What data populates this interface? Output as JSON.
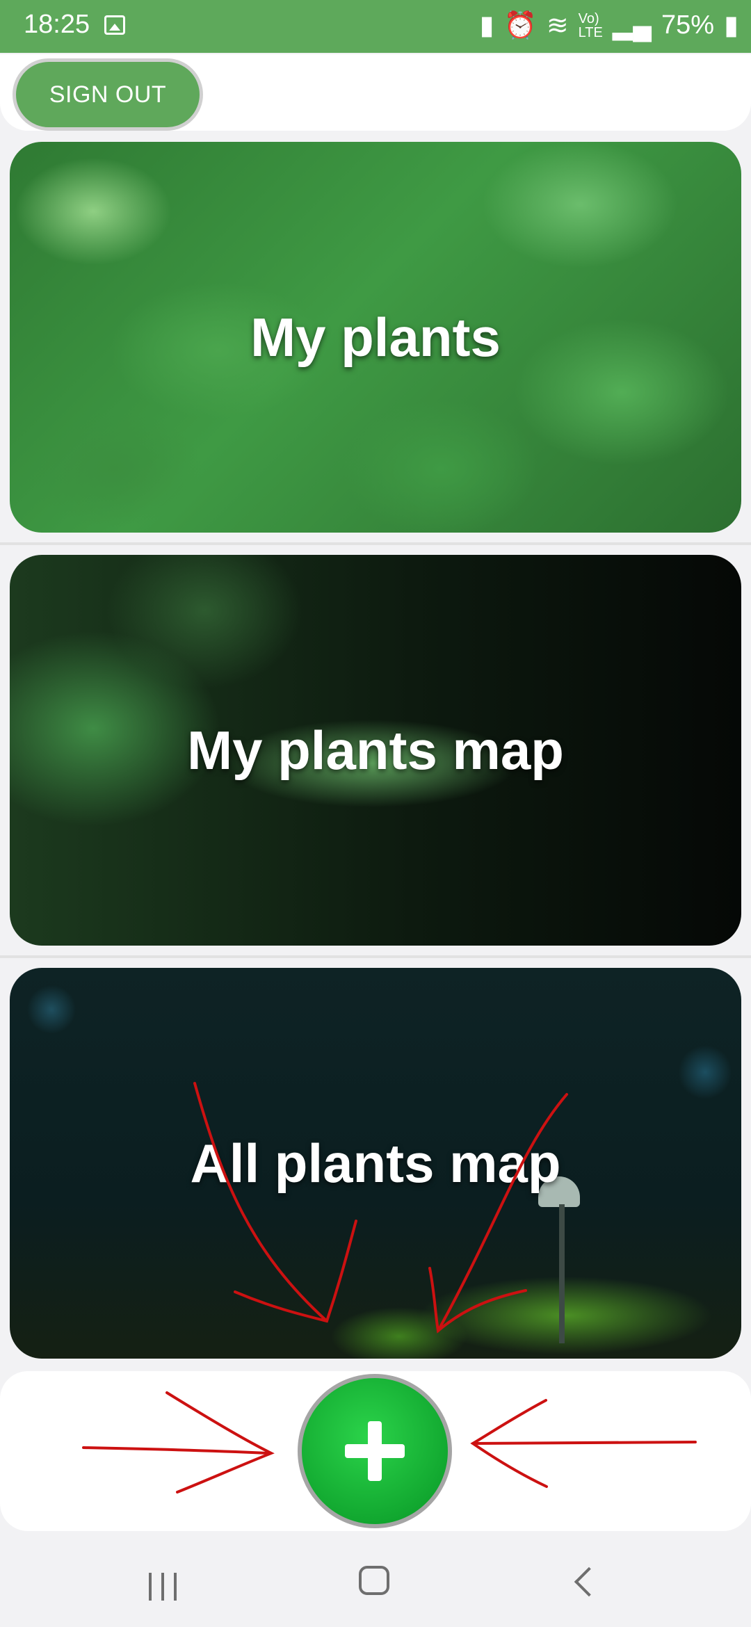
{
  "status_bar": {
    "time": "18:25",
    "battery_percent": "75%",
    "icons": [
      "gallery-icon",
      "battery-saver-icon",
      "alarm-icon",
      "wifi-icon",
      "volte-icon",
      "signal-icon",
      "battery-icon"
    ]
  },
  "toolbar": {
    "sign_out_label": "SIGN OUT"
  },
  "cards": {
    "my_plants": "My plants",
    "my_plants_map": "My plants map",
    "all_plants_map": "All plants map"
  },
  "fab": {
    "icon": "plus-icon",
    "color": "#1fbf3c"
  },
  "colors": {
    "accent": "#5fa85b",
    "annotation": "#cc1111"
  },
  "navigation": {
    "icons": [
      "recents-icon",
      "home-icon",
      "back-icon"
    ]
  }
}
